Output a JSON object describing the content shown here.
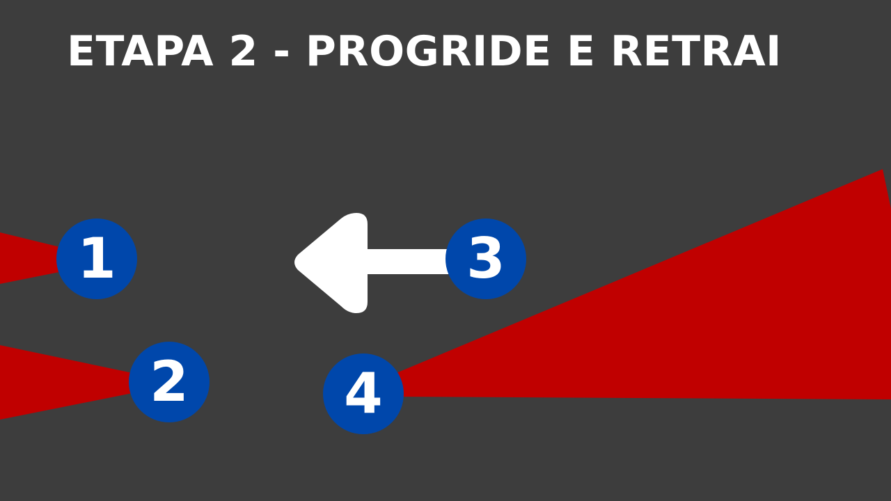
{
  "title": "ETAPA 2 - PROGRIDE E RETRAI",
  "colors": {
    "background": "#3d3d3d",
    "title_text": "#ffffff",
    "cone": "#c00000",
    "marker_fill": "#0047ab",
    "marker_text": "#ffffff",
    "arrow": "#ffffff"
  },
  "markers": [
    {
      "id": "m1",
      "label": "1"
    },
    {
      "id": "m2",
      "label": "2"
    },
    {
      "id": "m3",
      "label": "3"
    },
    {
      "id": "m4",
      "label": "4"
    }
  ],
  "arrow": {
    "direction": "left",
    "icon": "arrow-left-icon"
  }
}
